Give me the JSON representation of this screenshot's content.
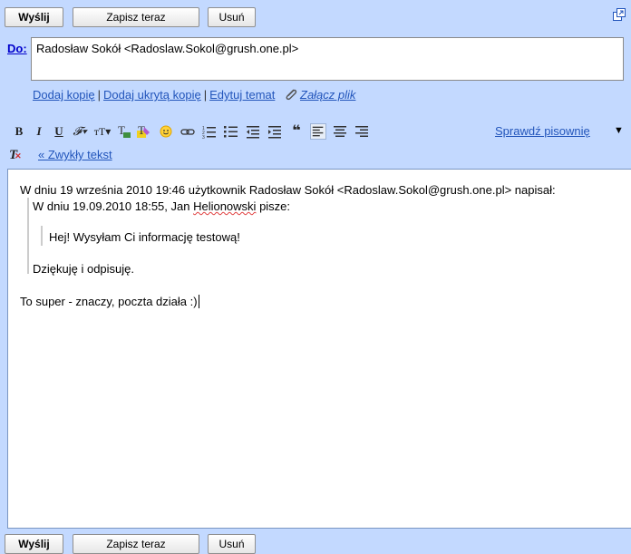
{
  "top_bar": {
    "send_label": "Wyślij",
    "save_label": "Zapisz teraz",
    "delete_label": "Usuń"
  },
  "bottom_bar": {
    "send_label": "Wyślij",
    "save_label": "Zapisz teraz",
    "delete_label": "Usuń"
  },
  "recipients": {
    "to_label": "Do:",
    "to_value": "Radosław Sokół <Radoslaw.Sokol@grush.one.pl>"
  },
  "compose_links": {
    "add_cc": "Dodaj kopię",
    "add_bcc": "Dodaj ukrytą kopię",
    "edit_subject": "Edytuj temat",
    "attach": "Załącz plik",
    "separator": "|"
  },
  "format_toolbar": {
    "spell_check": "Sprawdź pisownię",
    "plain_text": "« Zwykły tekst"
  },
  "message": {
    "line_attrib": "W dniu 19 września 2010 19:46 użytkownik Radosław Sokół <Radoslaw.Sokol@grush.one.pl> napisał:",
    "line_attrib2_prefix": "W dniu 19.09.2010 18:55, Jan ",
    "line_attrib2_name": "Helionowski",
    "line_attrib2_suffix": " pisze:",
    "line_quote_inner": "Hej! Wysyłam Ci informację testową!",
    "line_quote_outer": "Dziękuję i odpisuję.",
    "line_reply": "To super - znaczy, poczta działa :)"
  },
  "colors": {
    "background": "#c3d9ff",
    "link": "#2255bb"
  }
}
